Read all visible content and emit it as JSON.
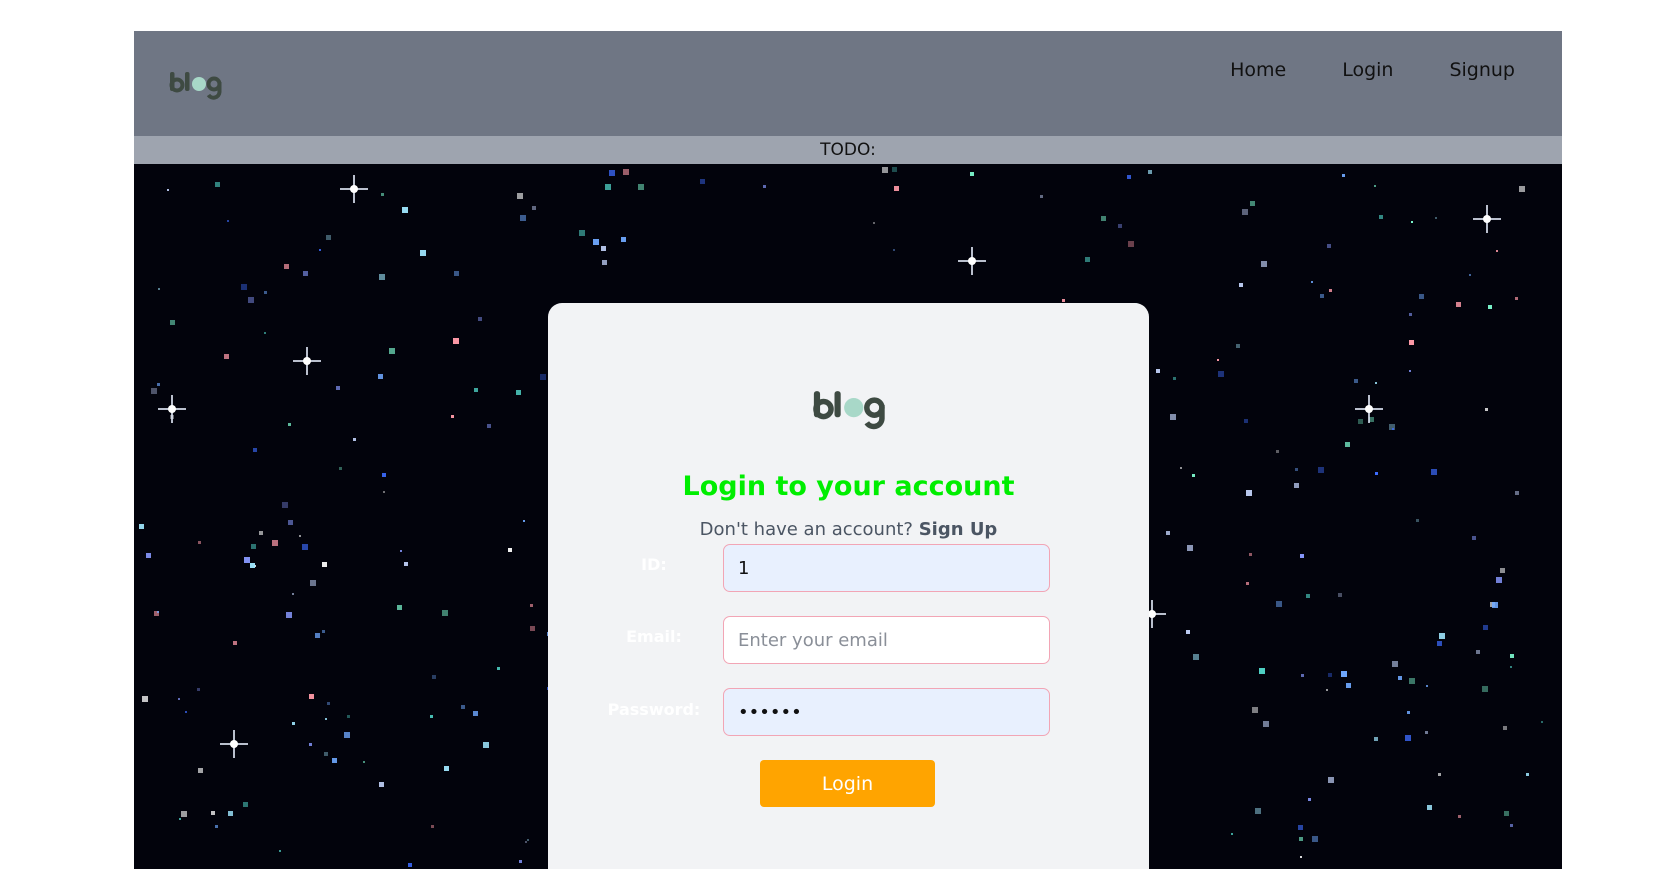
{
  "brand": {
    "logo_text": "blog",
    "logo_color": "#3e4a42",
    "logo_dot_color": "#a8d8c8"
  },
  "navbar": {
    "links": [
      "Home",
      "Login",
      "Signup"
    ]
  },
  "todo_bar": {
    "text": "TODO:"
  },
  "login_card": {
    "title": "Login to your account",
    "signup_prompt": "Don't have an account?",
    "signup_link": "Sign Up",
    "fields": {
      "id": {
        "label": "ID:",
        "value": "1",
        "placeholder": ""
      },
      "email": {
        "label": "Email:",
        "value": "",
        "placeholder": "Enter your email"
      },
      "password": {
        "label": "Password:",
        "value": "123456",
        "placeholder": ""
      }
    },
    "submit_label": "Login"
  },
  "colors": {
    "title": "#00ee00",
    "button": "#ffa400",
    "navbar": "#6f7684",
    "todo_bar": "#9ea4af",
    "background": "#02030c"
  }
}
